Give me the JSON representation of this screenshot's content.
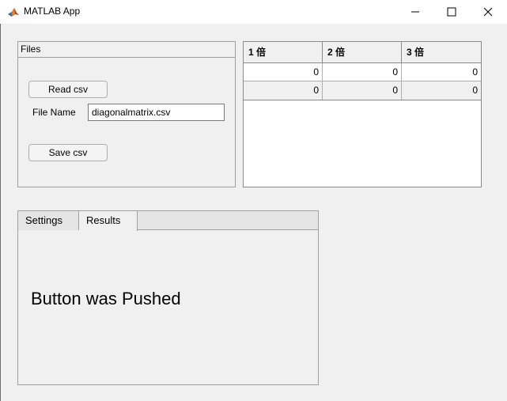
{
  "window": {
    "title": "MATLAB App",
    "controls": [
      "minimize",
      "maximize",
      "close"
    ]
  },
  "files_panel": {
    "title": "Files",
    "read_button": "Read csv",
    "file_name_label": "File Name",
    "file_name_value": "diagonalmatrix.csv",
    "save_button": "Save csv"
  },
  "table": {
    "columns": [
      "1 倍",
      "2 倍",
      "3 倍"
    ],
    "rows": [
      [
        "0",
        "0",
        "0"
      ],
      [
        "0",
        "0",
        "0"
      ]
    ]
  },
  "tabs": {
    "items": [
      {
        "label": "Settings",
        "selected": false
      },
      {
        "label": "Results",
        "selected": true
      }
    ],
    "results_text": "Button was Pushed"
  },
  "colors": {
    "background": "#f0f0f0",
    "titlebar": "#ffffff",
    "border": "#a0a0a0"
  }
}
